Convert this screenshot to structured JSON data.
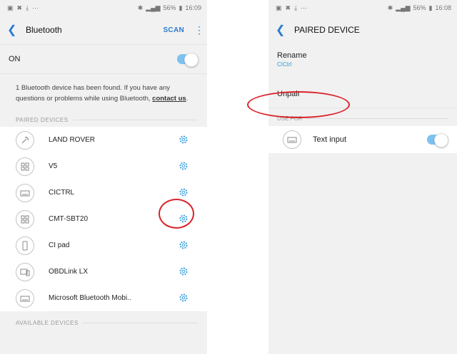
{
  "left": {
    "status": {
      "time": "16:09",
      "battery": "56%"
    },
    "title": "Bluetooth",
    "scan_label": "SCAN",
    "on_label": "ON",
    "info_text": "1 Bluetooth device has been found. If you have any questions or problems while using Bluetooth,",
    "contact_link": "contact us",
    "info_end": ".",
    "paired_header": "PAIRED DEVICES",
    "devices": [
      {
        "name": "LAND ROVER",
        "icon": "steering-icon"
      },
      {
        "name": "V5",
        "icon": "multi-device-icon"
      },
      {
        "name": "CICTRL",
        "icon": "keyboard-icon"
      },
      {
        "name": "CMT-SBT20",
        "icon": "multi-device-icon"
      },
      {
        "name": "CI pad",
        "icon": "phone-icon"
      },
      {
        "name": "OBDLink LX",
        "icon": "computer-icon"
      },
      {
        "name": "Microsoft Bluetooth Mobi..",
        "icon": "keyboard-icon"
      }
    ],
    "available_header": "AVAILABLE DEVICES"
  },
  "right": {
    "status": {
      "time": "16:08",
      "battery": "56%"
    },
    "title": "PAIRED DEVICE",
    "rename_label": "Rename",
    "rename_value": "CICtrl",
    "unpair_label": "Unpair",
    "usefor_header": "USE FOR",
    "text_input_label": "Text input"
  },
  "colors": {
    "accent": "#2a7bd1",
    "toggle_on": "#7cc2f1",
    "annotation": "#d9232a"
  }
}
